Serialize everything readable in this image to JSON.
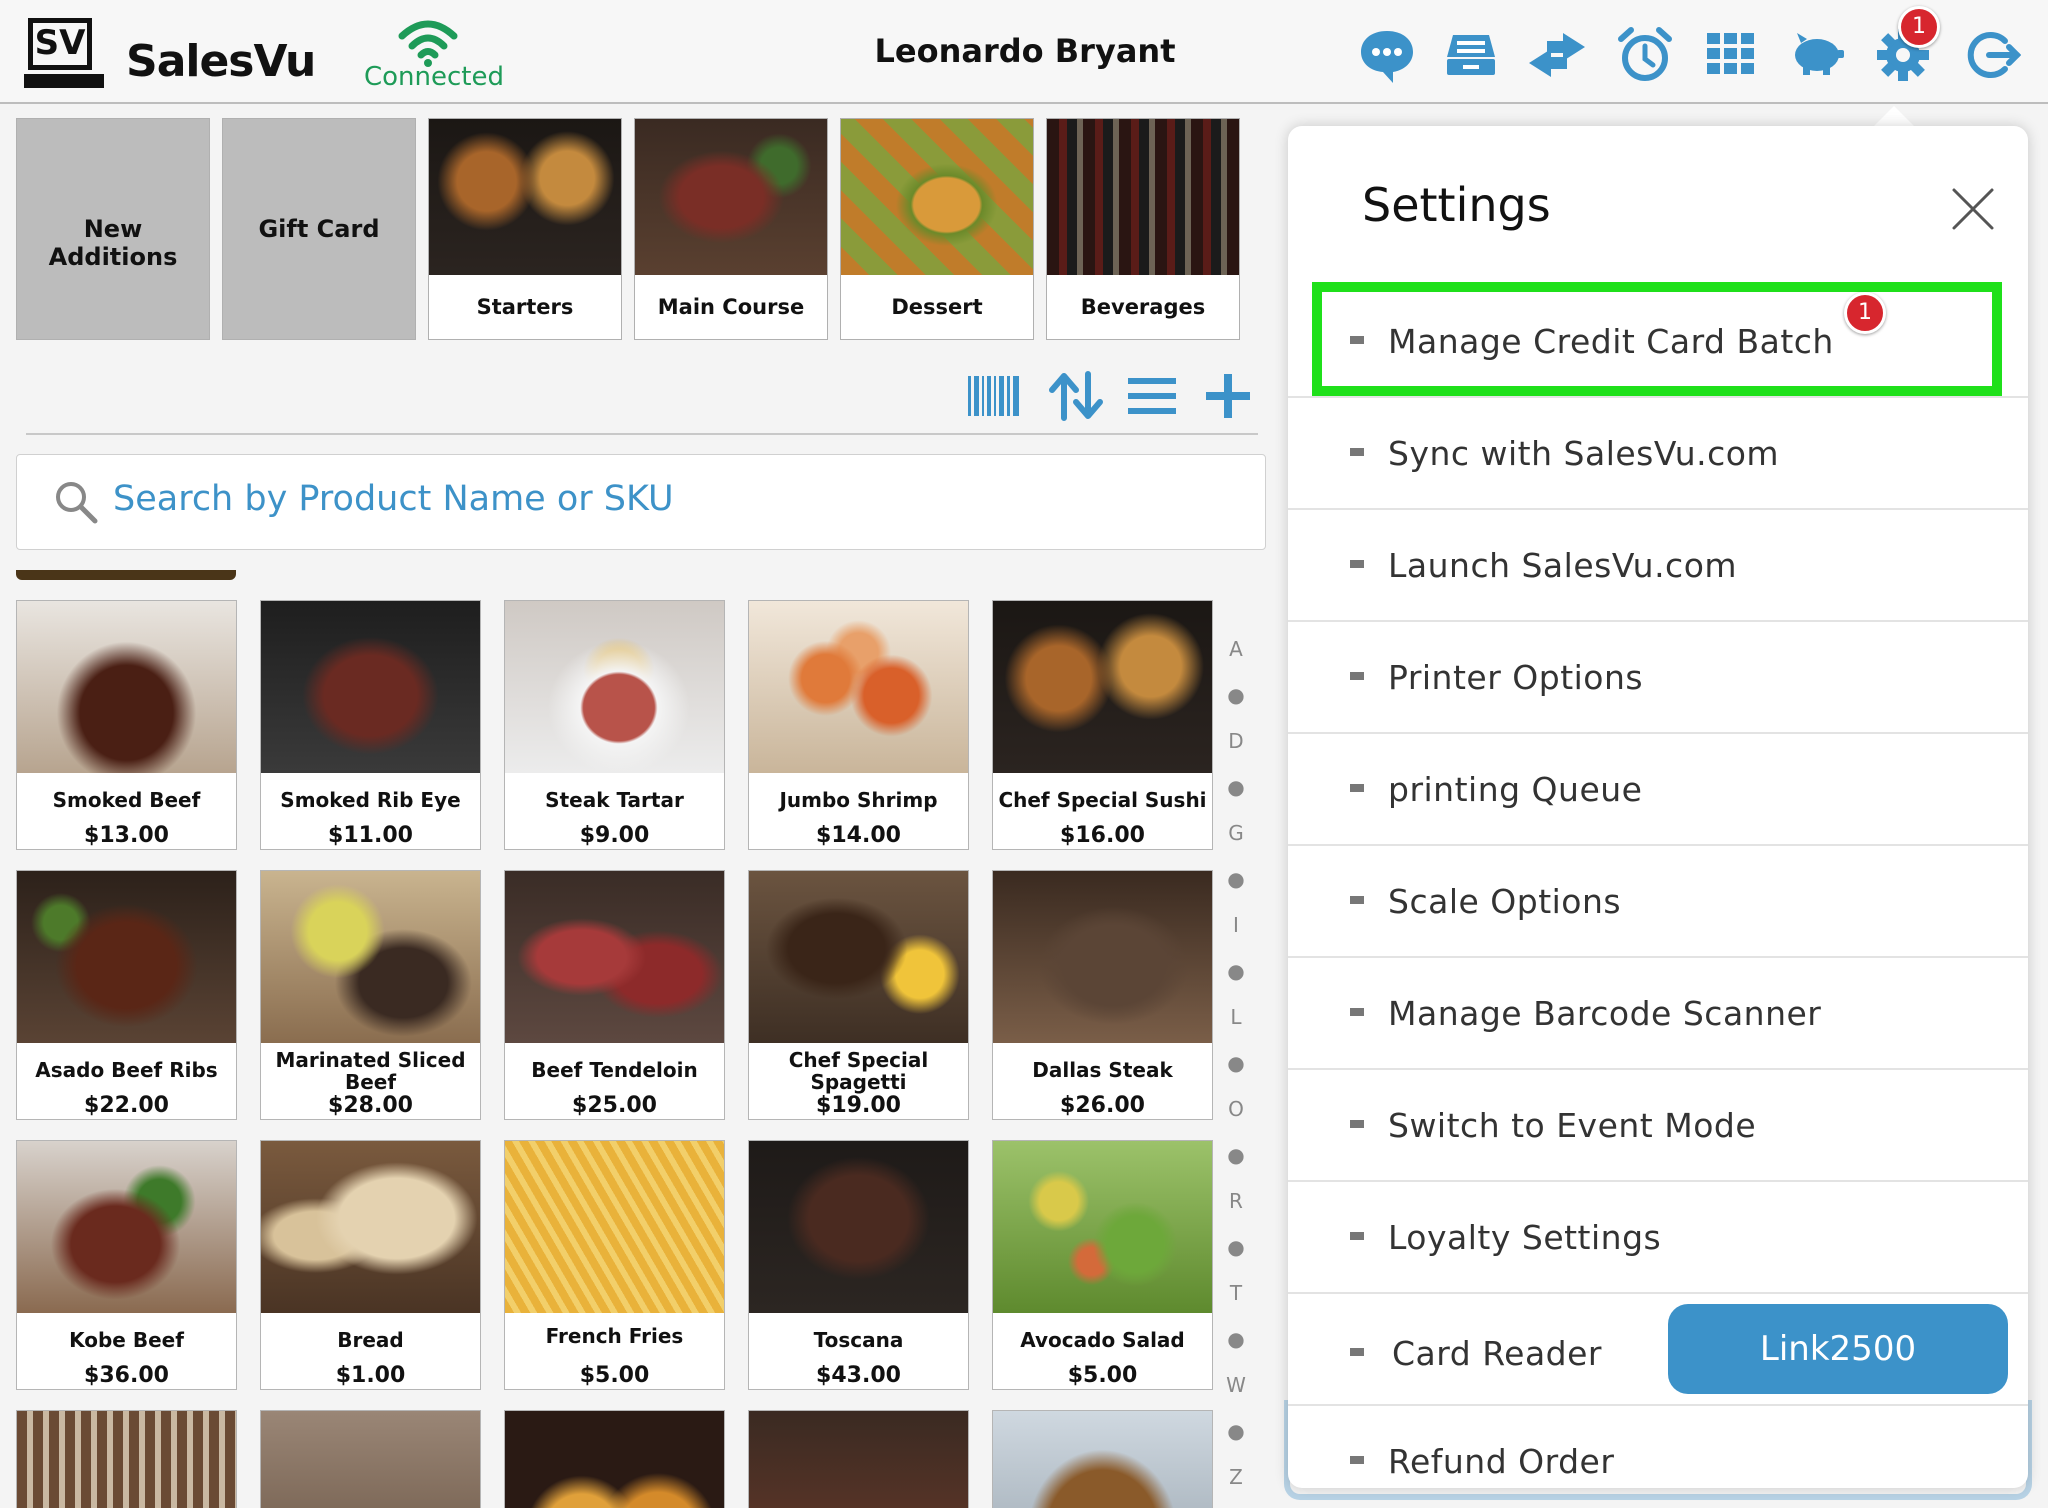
{
  "header": {
    "logo_text": "SV",
    "brand": "SalesVu",
    "connection_status": "Connected",
    "user_name": "Leonardo Bryant",
    "icons": [
      "chat-icon",
      "cash-drawer-icon",
      "transfer-icon",
      "alarm-clock-icon",
      "grid-icon",
      "piggy-bank-icon",
      "gear-icon",
      "logout-icon"
    ],
    "settings_badge": "1"
  },
  "categories": [
    {
      "label": "New Additions",
      "type": "text"
    },
    {
      "label": "Gift Card",
      "type": "text"
    },
    {
      "label": "Starters",
      "type": "image"
    },
    {
      "label": "Main Course",
      "type": "image"
    },
    {
      "label": "Dessert",
      "type": "image"
    },
    {
      "label": "Beverages",
      "type": "image"
    }
  ],
  "toolbar": {
    "icons": [
      "barcode-icon",
      "sort-icon",
      "list-icon",
      "add-icon"
    ]
  },
  "search": {
    "placeholder": "Search by Product Name or SKU"
  },
  "products": [
    {
      "name": "Smoked Beef",
      "price": "$13.00"
    },
    {
      "name": "Smoked Rib Eye",
      "price": "$11.00"
    },
    {
      "name": "Steak Tartar",
      "price": "$9.00"
    },
    {
      "name": "Jumbo Shrimp",
      "price": "$14.00"
    },
    {
      "name": "Chef Special Sushi",
      "price": "$16.00"
    },
    {
      "name": "Asado Beef Ribs",
      "price": "$22.00"
    },
    {
      "name": "Marinated Sliced Beef",
      "price": "$28.00"
    },
    {
      "name": "Beef Tendeloin",
      "price": "$25.00"
    },
    {
      "name": "Chef Special Spagetti",
      "price": "$19.00"
    },
    {
      "name": "Dallas Steak",
      "price": "$26.00"
    },
    {
      "name": "Kobe Beef",
      "price": "$36.00"
    },
    {
      "name": "Bread",
      "price": "$1.00"
    },
    {
      "name": "French Fries",
      "price": "$5.00"
    },
    {
      "name": "Toscana",
      "price": "$43.00"
    },
    {
      "name": "Avocado Salad",
      "price": "$5.00"
    }
  ],
  "alphabet_index": [
    "A",
    "D",
    "G",
    "I",
    "L",
    "O",
    "R",
    "T",
    "W",
    "Z"
  ],
  "colors": {
    "accent": "#3c92c9",
    "connected": "#1e9b58",
    "badge": "#d7262e",
    "highlight": "#1fe01a"
  },
  "settings": {
    "title": "Settings",
    "items": [
      {
        "label": "Manage Credit Card Batch",
        "badge": "1"
      },
      {
        "label": "Sync with SalesVu.com"
      },
      {
        "label": "Launch SalesVu.com"
      },
      {
        "label": "Printer Options"
      },
      {
        "label": "printing Queue"
      },
      {
        "label": "Scale Options"
      },
      {
        "label": "Manage Barcode Scanner"
      },
      {
        "label": "Switch to Event Mode"
      },
      {
        "label": "Loyalty Settings"
      },
      {
        "label": "Card Reader",
        "button": "Link2500"
      },
      {
        "label": "Refund Order"
      }
    ]
  }
}
